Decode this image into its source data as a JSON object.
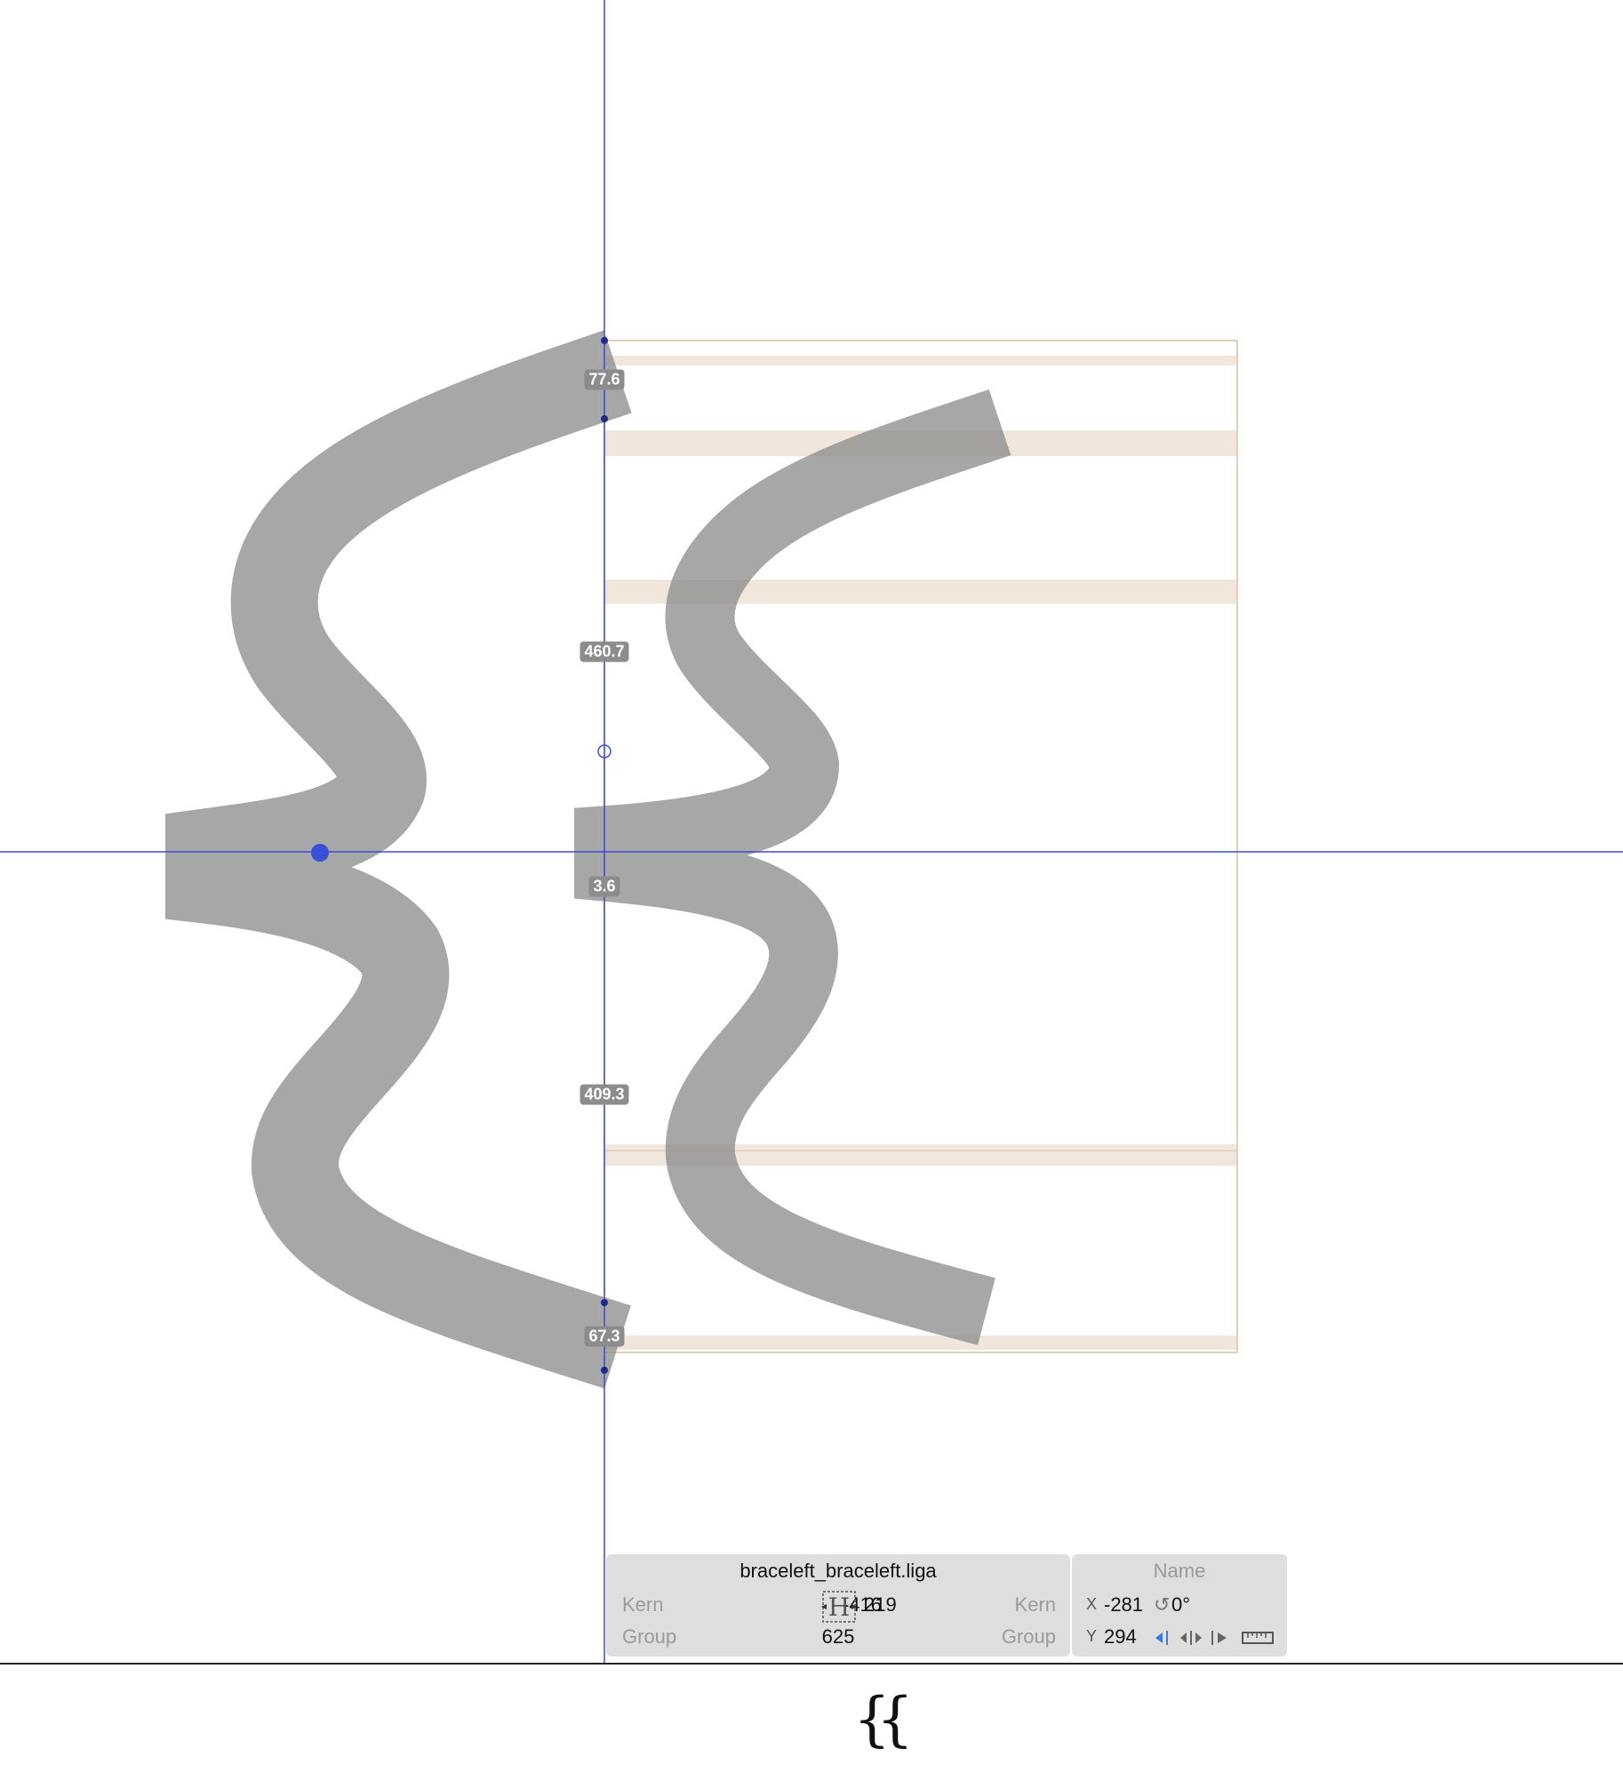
{
  "canvas": {
    "measurements": {
      "top_cap": "77.6",
      "upper_span": "460.7",
      "middle_gap": "3.6",
      "lower_span": "409.3",
      "bottom_cap": "67.3"
    },
    "colors": {
      "guide_line": "#3a4fd8",
      "glyph_fill": "#8a8a8a",
      "metric_band": "#f0e6dc",
      "metric_border": "#e2cdb8",
      "node": "#3a4fd8"
    }
  },
  "info_panel": {
    "glyph_name": "braceleft_braceleft.liga",
    "name_placeholder": "Name",
    "left_kern_label": "Kern",
    "left_group_label": "Group",
    "right_kern_label": "Kern",
    "right_group_label": "Group",
    "lsb": "-416",
    "rsb": "219",
    "width": "625",
    "x_label": "X",
    "x_value": "-281",
    "angle": "0°",
    "y_label": "Y",
    "y_value": "294",
    "icons": [
      "metrics-link-icon",
      "align-left-icon",
      "align-center-icon",
      "align-right-icon",
      "ruler-icon"
    ]
  },
  "preview": {
    "text": "{{"
  }
}
